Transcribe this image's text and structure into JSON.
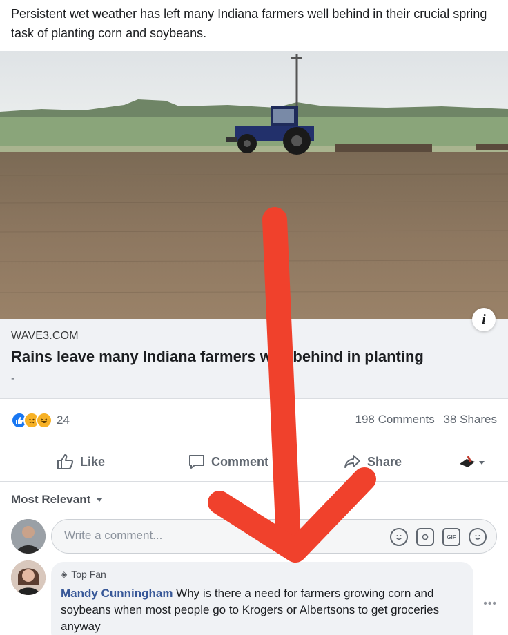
{
  "post": {
    "text": "Persistent wet weather has left many Indiana farmers well behind in their crucial spring task of planting corn and soybeans."
  },
  "link_preview": {
    "domain": "WAVE3.COM",
    "title": "Rains leave many Indiana farmers well behind in planting",
    "description": "-",
    "info_icon": "i"
  },
  "reactions": {
    "icons": [
      "like-icon",
      "sad-icon",
      "haha-icon"
    ],
    "count": "24",
    "comments": "198 Comments",
    "shares": "38 Shares"
  },
  "actions": {
    "like": "Like",
    "comment": "Comment",
    "share": "Share"
  },
  "comments_section": {
    "sort_label": "Most Relevant",
    "compose_placeholder": "Write a comment...",
    "items": [
      {
        "badge": "Top Fan",
        "author": "Mandy Cunningham",
        "text": " Why is there a need for farmers growing corn and soybeans when most people go to Krogers or Albertsons to get groceries anyway"
      }
    ]
  },
  "colors": {
    "facebook_blue": "#1877f2",
    "author_link": "#385898",
    "annotation_arrow": "#f0412c"
  }
}
